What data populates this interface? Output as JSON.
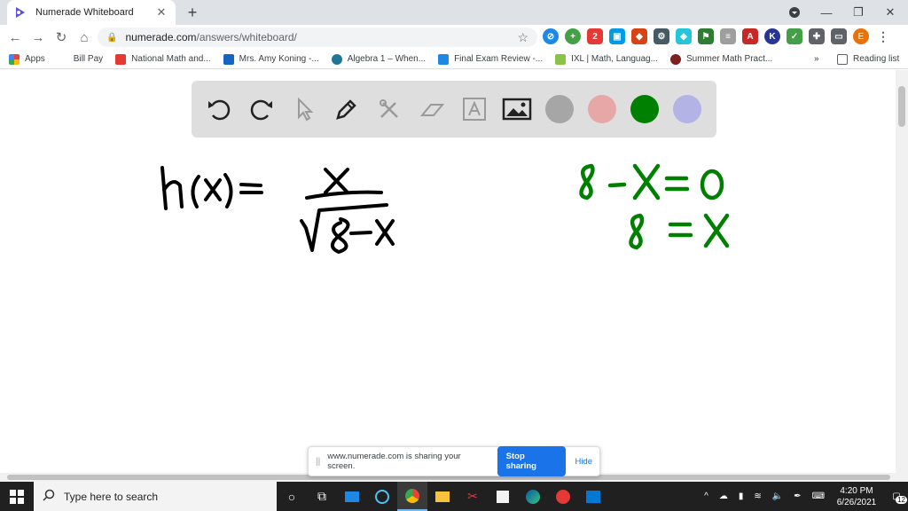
{
  "tab": {
    "title": "Numerade Whiteboard",
    "close": "✕",
    "new": "+"
  },
  "window": {
    "minimize": "—",
    "restore": "❐",
    "close": "✕"
  },
  "nav": {
    "back": "←",
    "forward": "→",
    "reload": "↻",
    "home": "⌂"
  },
  "omnibox": {
    "host": "numerade.com",
    "path": "/answers/whiteboard/"
  },
  "profile_initial": "E",
  "bookmarks": [
    {
      "label": "Apps",
      "color": "#4285f4"
    },
    {
      "label": "Bill Pay",
      "color": "#ffffff"
    },
    {
      "label": "National Math and...",
      "color": "#e53935"
    },
    {
      "label": "Mrs. Amy Koning -...",
      "color": "#1565c0"
    },
    {
      "label": "Algebra 1 – When...",
      "color": "#21759b"
    },
    {
      "label": "Final Exam Review -...",
      "color": "#1e88e5"
    },
    {
      "label": "IXL | Math, Languag...",
      "color": "#8bc34a"
    },
    {
      "label": "Summer Math Pract...",
      "color": "#7b1f1f"
    }
  ],
  "bookmarks_more": "»",
  "reading_list": "Reading list",
  "whiteboard": {
    "colors": [
      "#a6a6a6",
      "#e8a7a7",
      "#008000",
      "#b3b3e6"
    ],
    "equation_left": "h(x) = x / √(8 − x)",
    "equation_right_1": "8 − x = 0",
    "equation_right_2": "8 = x"
  },
  "share_banner": {
    "message": "www.numerade.com is sharing your screen.",
    "stop": "Stop sharing",
    "hide": "Hide"
  },
  "taskbar": {
    "search_placeholder": "Type here to search",
    "time": "4:20 PM",
    "date": "6/26/2021",
    "notifications": "12"
  }
}
